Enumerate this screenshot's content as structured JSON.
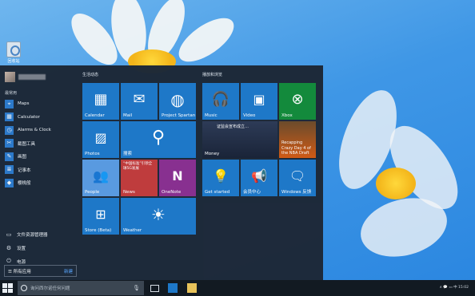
{
  "colors": {
    "desktop": "#3f97e6",
    "start_menu": "#1d2938",
    "tile_blue": "#1e78c8",
    "tile_green": "#138a3a",
    "tile_red": "#c23b3b",
    "tile_orange": "#d35a12",
    "tile_light": "#5a9be0",
    "taskbar": "#121a22"
  },
  "desktop": {
    "icon": {
      "label": "回收站",
      "icon": "recycle-bin-icon"
    }
  },
  "start": {
    "section_title": "最常用",
    "apps": [
      {
        "label": "Maps",
        "icon": "map-icon"
      },
      {
        "label": "Calculator",
        "icon": "calculator-icon"
      },
      {
        "label": "Alarms & Clock",
        "icon": "clock-icon"
      },
      {
        "label": "截图工具",
        "icon": "snipping-tool-icon"
      },
      {
        "label": "画图",
        "icon": "paint-icon"
      },
      {
        "label": "记事本",
        "icon": "notepad-icon"
      },
      {
        "label": "樱桃般",
        "icon": "app-icon"
      }
    ],
    "system": [
      {
        "label": "文件资源管理器",
        "icon": "folder-icon"
      },
      {
        "label": "设置",
        "icon": "gear-icon"
      },
      {
        "label": "电源",
        "icon": "power-icon"
      }
    ],
    "all_apps": {
      "label": "所有应用",
      "badge": "新建"
    }
  },
  "tiles": {
    "group1_title": "生活动态",
    "group2_title": "播放和浏览",
    "calendar": "Calendar",
    "mail": "Mail",
    "project_spartan": "Project Spartan",
    "music": "Music",
    "video": "Video",
    "xbox": "Xbox",
    "photos": "Photos",
    "search": "搜索",
    "money": "Money",
    "money_headline": "证监会宣布成立…",
    "sports": "Recapping Crazy Day 4 of the NBA Draft",
    "people": "People",
    "news": "News",
    "news_headline": "“中国标准”引领全球5G发展",
    "onenote": "OneNote",
    "get_started": "Get started",
    "phone_companion": "会员中心",
    "windows_feedback": "Windows 反馈",
    "store": "Store (Beta)",
    "weather": "Weather"
  },
  "taskbar": {
    "search_placeholder": "询问西尔诺任何问题",
    "tray_text": "∧ 💬 ▭ 中 15:02"
  }
}
